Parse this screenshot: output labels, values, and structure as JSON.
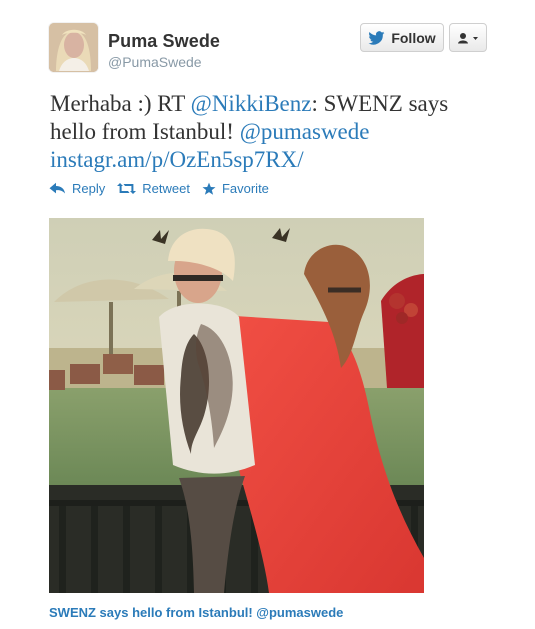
{
  "tweet": {
    "author": {
      "name": "Puma Swede",
      "handle": "@PumaSwede",
      "avatar_icon": "profile-photo"
    },
    "follow_label": "Follow",
    "menu_icon": "user-menu-icon",
    "text_prefix": "Merhaba :) RT ",
    "mention1": "@NikkiBenz",
    "text_middle": ": SWENZ says hello from Istanbul! ",
    "mention2": "@pumaswede",
    "link": "instagr.am/p/OzEn5sp7RX/",
    "actions": {
      "reply": "Reply",
      "retweet": "Retweet",
      "favorite": "Favorite"
    },
    "photo_icon": "embedded-photo",
    "photo_caption": "SWENZ says hello from Istanbul! @pumaswede"
  },
  "colors": {
    "link": "#2b7bb9",
    "text": "#333333",
    "muted": "#8899a6",
    "button_border": "#cfcfcf"
  }
}
